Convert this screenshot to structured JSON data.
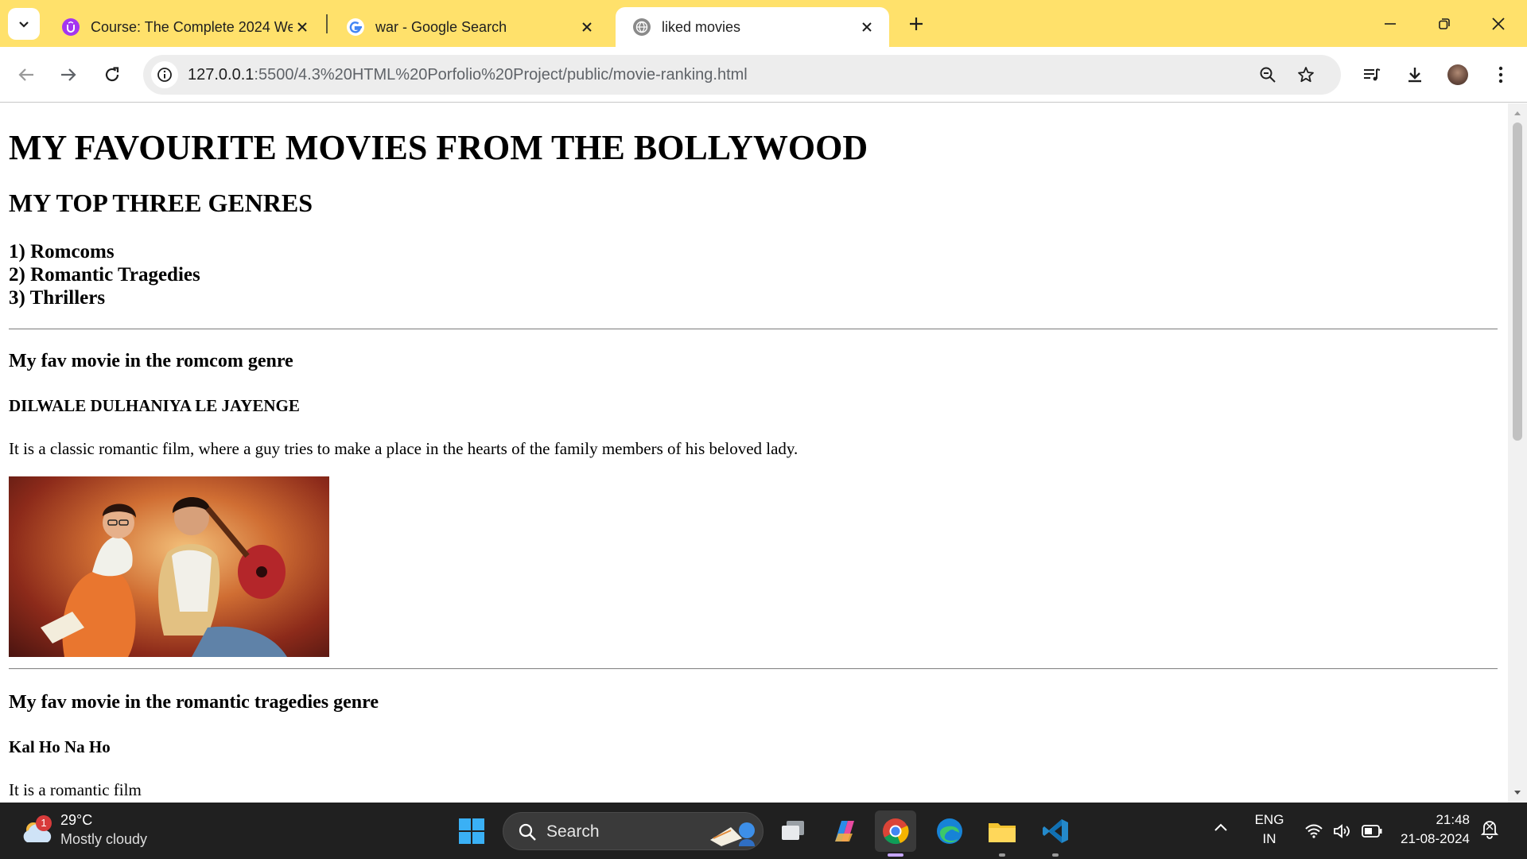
{
  "tabs": [
    {
      "title": "Course: The Complete 2024 We",
      "icon": "udemy-icon",
      "active": false
    },
    {
      "title": "war - Google Search",
      "icon": "google-icon",
      "active": false
    },
    {
      "title": "liked movies",
      "icon": "globe-icon",
      "active": true
    }
  ],
  "address_bar": {
    "host": "127.0.0.1",
    "path": ":5500/4.3%20HTML%20Porfolio%20Project/public/movie-ranking.html"
  },
  "page": {
    "h1": "MY FAVOURITE MOVIES FROM THE BOLLYWOOD",
    "h2": "MY TOP THREE GENRES",
    "genres": [
      "1) Romcoms",
      "2) Romantic Tragedies",
      "3) Thrillers"
    ],
    "section1": {
      "heading": "My fav movie in the romcom genre",
      "movie": "DILWALE DULHANIYA LE JAYENGE",
      "description": "It is a classic romantic film, where a guy tries to make a place in the hearts of the family members of his beloved lady."
    },
    "section2": {
      "heading": "My fav movie in the romantic tragedies genre",
      "movie": "Kal Ho Na Ho",
      "description": "It is a romantic film"
    }
  },
  "taskbar": {
    "weather_badge": "1",
    "temperature": "29°C",
    "weather": "Mostly cloudy",
    "search_label": "Search",
    "lang_top": "ENG",
    "lang_bottom": "IN",
    "time": "21:48",
    "date": "21-08-2024"
  },
  "colors": {
    "tabstrip": "#ffe16b",
    "omnibox": "#ededed",
    "taskbar": "#202020"
  }
}
